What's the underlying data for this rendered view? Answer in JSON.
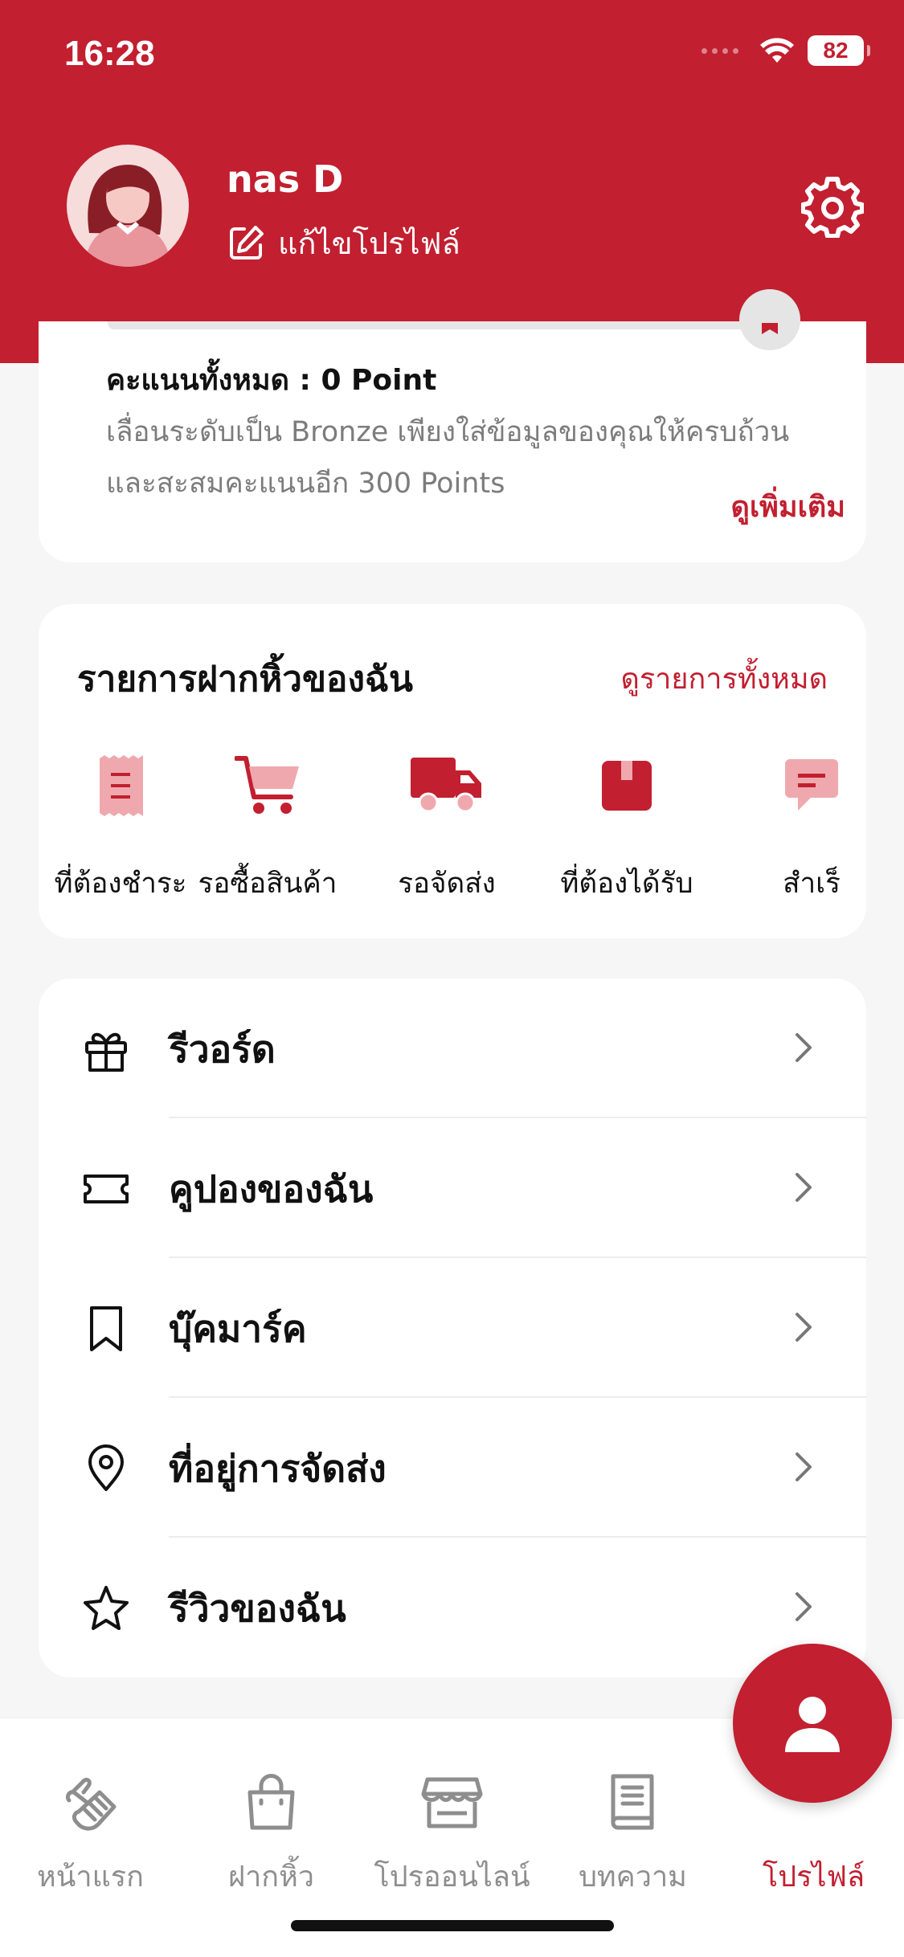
{
  "status_bar": {
    "time": "16:28",
    "battery": "82"
  },
  "profile": {
    "name": "nas D",
    "edit_label": "แก้ไขโปรไฟล์"
  },
  "points": {
    "title": "คะแนนทั้งหมด : 0 Point",
    "description": "เลื่อนระดับเป็น Bronze เพียงใส่ข้อมูลของคุณให้ครบถ้วน และสะสมคะแนนอีก 300 Points",
    "see_more": "ดูเพิ่มเติม"
  },
  "orders": {
    "title": "รายการฝากหิ้วของฉัน",
    "view_all": "ดูรายการทั้งหมด",
    "items": [
      {
        "label": "ที่ต้องชำระ",
        "icon": "receipt-icon"
      },
      {
        "label": "รอซื้อสินค้า",
        "icon": "cart-icon"
      },
      {
        "label": "รอจัดส่ง",
        "icon": "truck-icon"
      },
      {
        "label": "ที่ต้องได้รับ",
        "icon": "box-icon"
      },
      {
        "label": "สำเร็",
        "icon": "message-icon"
      }
    ]
  },
  "menu": [
    {
      "label": "รีวอร์ด",
      "icon": "gift-icon"
    },
    {
      "label": "คูปองของฉัน",
      "icon": "ticket-icon"
    },
    {
      "label": "บุ๊คมาร์ค",
      "icon": "bookmark-icon"
    },
    {
      "label": "ที่อยู่การจัดส่ง",
      "icon": "location-pin-icon"
    },
    {
      "label": "รีวิวของฉัน",
      "icon": "star-icon"
    }
  ],
  "tabs": [
    {
      "label": "หน้าแรก",
      "icon": "hand-bag-icon",
      "active": false
    },
    {
      "label": "ฝากหิ้ว",
      "icon": "shopping-bag-icon",
      "active": false
    },
    {
      "label": "โปรออนไลน์",
      "icon": "store-icon",
      "active": false
    },
    {
      "label": "บทความ",
      "icon": "book-icon",
      "active": false
    },
    {
      "label": "โปรไฟล์",
      "icon": "profile-icon",
      "active": true
    }
  ],
  "colors": {
    "brand": "#c21f30",
    "muted": "#8e8e8e",
    "background": "#f6f6f6"
  }
}
